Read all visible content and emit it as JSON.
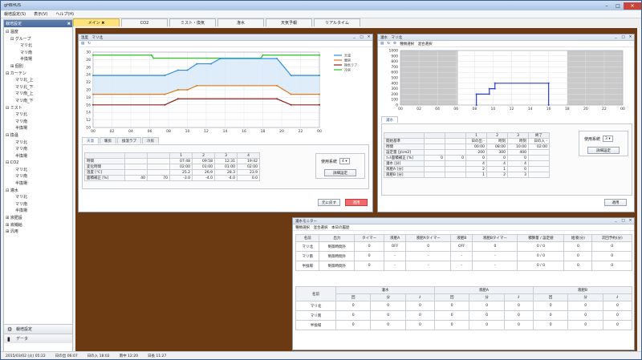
{
  "app": {
    "title": "gHBHUS",
    "menu": [
      "栽培設定(S)",
      "表示(V)",
      "ヘルプ(H)"
    ],
    "tabs": [
      {
        "label": "メイン ✖",
        "active": true
      },
      {
        "label": "CO2",
        "active": false
      },
      {
        "label": "ミスト・換気",
        "active": false
      },
      {
        "label": "潅水",
        "active": false
      },
      {
        "label": "天気予報",
        "active": false
      },
      {
        "label": "リアルタイム",
        "active": false
      }
    ]
  },
  "sidebar": {
    "header": "栽培設定",
    "close": "✖",
    "tree": [
      {
        "label": "⊟ 温度",
        "level": 0
      },
      {
        "label": "⊟ グループ",
        "level": 1
      },
      {
        "label": "マリ北",
        "level": 3
      },
      {
        "label": "マリ南",
        "level": 3
      },
      {
        "label": "半換場",
        "level": 3
      },
      {
        "label": "⊞ 個別",
        "level": 1
      },
      {
        "label": "⊟ カーテン",
        "level": 0
      },
      {
        "label": "マリ北_上",
        "level": 2
      },
      {
        "label": "マリ北_下",
        "level": 2
      },
      {
        "label": "マリ南_上",
        "level": 2
      },
      {
        "label": "マリ南_下",
        "level": 2
      },
      {
        "label": "⊟ ミスト",
        "level": 0
      },
      {
        "label": "マリ北",
        "level": 2
      },
      {
        "label": "マリ南",
        "level": 2
      },
      {
        "label": "半換場",
        "level": 2
      },
      {
        "label": "⊟ 換温",
        "level": 0
      },
      {
        "label": "マリ北",
        "level": 2
      },
      {
        "label": "マリ南",
        "level": 2
      },
      {
        "label": "半換場",
        "level": 2
      },
      {
        "label": "⊟ CO2",
        "level": 0
      },
      {
        "label": "マリ北",
        "level": 2
      },
      {
        "label": "マリ南",
        "level": 2
      },
      {
        "label": "半換場",
        "level": 2
      },
      {
        "label": "⊟ 灌水",
        "level": 0
      },
      {
        "label": "マリ北",
        "level": 2
      },
      {
        "label": "マリ南",
        "level": 2
      },
      {
        "label": "半換場",
        "level": 2
      },
      {
        "label": "⊞ 液肥設",
        "level": 0
      },
      {
        "label": "⊞ 液補給",
        "level": 0
      },
      {
        "label": "⊞ 汎用",
        "level": 0
      }
    ],
    "bottom_buttons": [
      "栽培設定",
      "データ"
    ]
  },
  "status": [
    "2015/03/02 (火) 05:22",
    "日の出 06:07",
    "日の入 18:02",
    "南中 12:20",
    "日長 11:27"
  ],
  "temp_panel": {
    "title": "温度　マリ北",
    "legend": [
      {
        "name": "天温",
        "color": "#2f8fe0"
      },
      {
        "name": "暖房",
        "color": "#e07a1f"
      },
      {
        "name": "換気ラブ",
        "color": "#8b2020"
      },
      {
        "name": "冷房",
        "color": "#27c427"
      }
    ],
    "subtabs": [
      "天温",
      "暖房",
      "換温ラブ",
      "冷房"
    ],
    "table": {
      "headers": [
        "",
        "",
        "",
        "1",
        "2",
        "3",
        "4"
      ],
      "rows": [
        [
          "時間",
          "",
          "",
          "07:48",
          "09:58",
          "12:31",
          "19:42"
        ],
        [
          "変化時間",
          "",
          "",
          "02:00",
          "01:00",
          "01:00",
          "02:00"
        ],
        [
          "温度 [℃]",
          "",
          "",
          "25.2",
          "26.9",
          "28.3",
          "23.9"
        ],
        [
          "面積補正 [%]",
          "40",
          "70",
          "-3.0",
          "-4.0",
          "-4.0",
          "0.0"
        ]
      ]
    },
    "mode_label": "使用系統",
    "mode_value": "4",
    "detail_button": "詳細設定",
    "revert_button": "元に戻す",
    "apply_button": "適用"
  },
  "irr_panel": {
    "title": "灌水　マリ北",
    "tools": "種類選択　混合選択",
    "subtab": "灌水",
    "table": {
      "headers": [
        "",
        "",
        "",
        "1",
        "2",
        "3",
        "終了"
      ],
      "rows": [
        [
          "開始基準",
          "",
          "",
          "日の出 -",
          "時刻",
          "時刻",
          "日の入 -"
        ],
        [
          "時間",
          "",
          "",
          "00:00",
          "08:00",
          "10:00",
          "02:00"
        ],
        [
          "設定量 [J/cm2]",
          "",
          "",
          "200",
          "300",
          "400",
          ""
        ],
        [
          "ﾌｨﾙ面積補正 [%]",
          "0",
          "0",
          "0",
          "0",
          "0",
          ""
        ],
        [
          "灌水 [分]",
          "",
          "",
          "4",
          "4",
          "4",
          ""
        ],
        [
          "液肥A [分]",
          "",
          "",
          "2",
          "1",
          "0",
          ""
        ],
        [
          "液肥B [分]",
          "",
          "",
          "1",
          "2",
          "3",
          ""
        ]
      ]
    },
    "mode_label": "使用系統",
    "mode_value": "3",
    "detail_button": "詳細設定",
    "apply_button": "適用"
  },
  "monitor_panel": {
    "title": "灌水モニター",
    "tools": "種類選択　混合選択　本日の履歴",
    "top_headers": [
      "名前",
      "出力",
      "タイマー",
      "液肥A",
      "液肥Aタイマー",
      "液肥B",
      "液肥Bタイマー",
      "積算量 / 設定値",
      "給液(分)",
      "次回予約(分)"
    ],
    "top_rows": [
      [
        "マリ北",
        "制御時間外",
        "0",
        "OFF",
        "0",
        "OFF",
        "0",
        "0 / 0",
        "0",
        "0"
      ],
      [
        "マリ南",
        "制御時間外",
        "0",
        "-",
        "-",
        "-",
        "-",
        "0 / 0",
        "0",
        "0"
      ],
      [
        "半換場",
        "制御時間外",
        "0",
        "-",
        "-",
        "-",
        "-",
        "0 / 0",
        "0",
        "0"
      ]
    ],
    "bottom_groups": [
      "灌水",
      "液肥A",
      "液肥B"
    ],
    "bottom_sub": [
      "回",
      "分",
      "ℓ"
    ],
    "bottom_rows": [
      [
        "マリ北",
        "0",
        "0",
        "0",
        "0",
        "0",
        "0",
        "0",
        "0",
        "0"
      ],
      [
        "マリ南",
        "0",
        "0",
        "0",
        "0",
        "0",
        "0",
        "0",
        "0",
        "0"
      ],
      [
        "半換場",
        "0",
        "0",
        "0",
        "0",
        "0",
        "0",
        "0",
        "0",
        "0"
      ]
    ],
    "name_header": "名前"
  },
  "chart_data": [
    {
      "type": "line",
      "x_ticks": [
        "00",
        "02",
        "04",
        "06",
        "08",
        "10",
        "12",
        "14",
        "16",
        "18",
        "20",
        "22",
        "00"
      ],
      "y_ticks": [
        "10",
        "12",
        "14",
        "16",
        "18",
        "20",
        "22",
        "24",
        "26",
        "28",
        "30"
      ],
      "xlim": [
        0,
        24
      ],
      "ylim": [
        10,
        30
      ],
      "series": [
        {
          "name": "冷房",
          "color": "#27c427",
          "points": [
            [
              0,
              29.2
            ],
            [
              6.2,
              29.2
            ],
            [
              6.4,
              28.4
            ],
            [
              17.8,
              28.4
            ],
            [
              18,
              29.2
            ],
            [
              24,
              29.2
            ]
          ]
        },
        {
          "name": "天温",
          "color": "#2f8fe0",
          "points": [
            [
              0,
              23.8
            ],
            [
              7.6,
              23.8
            ],
            [
              9,
              25.2
            ],
            [
              10,
              25.2
            ],
            [
              11,
              26.9
            ],
            [
              12.5,
              26.9
            ],
            [
              13.5,
              28.3
            ],
            [
              19.5,
              28.3
            ],
            [
              21,
              23.8
            ],
            [
              24,
              23.8
            ]
          ]
        },
        {
          "name": "暖房",
          "color": "#e07a1f",
          "points": [
            [
              0,
              18.8
            ],
            [
              7.6,
              18.8
            ],
            [
              9,
              20.0
            ],
            [
              10,
              20.0
            ],
            [
              11,
              21.1
            ],
            [
              19.5,
              21.1
            ],
            [
              21,
              18.8
            ],
            [
              24,
              18.8
            ]
          ]
        },
        {
          "name": "換気ラブ",
          "color": "#8b2020",
          "points": [
            [
              0,
              16.0
            ],
            [
              7.6,
              16.0
            ],
            [
              9,
              17.6
            ],
            [
              19.5,
              17.6
            ],
            [
              21,
              16.0
            ],
            [
              24,
              16.0
            ]
          ]
        }
      ],
      "legend_position": "top-right",
      "grid": true
    },
    {
      "type": "line",
      "x_ticks": [
        "00",
        "02",
        "04",
        "06",
        "08",
        "10",
        "12",
        "14",
        "16",
        "18",
        "20",
        "22",
        "00"
      ],
      "y_ticks": [
        "0",
        "100",
        "200",
        "300",
        "400",
        "500",
        "600",
        "700",
        "800",
        "900",
        "1000"
      ],
      "xlim": [
        0,
        24
      ],
      "ylim": [
        0,
        1000
      ],
      "series": [
        {
          "name": "灌水",
          "color": "#2b3fd6",
          "points": [
            [
              8.2,
              0
            ],
            [
              8.2,
              200
            ],
            [
              9.6,
              200
            ],
            [
              9.6,
              300
            ],
            [
              10.2,
              300
            ],
            [
              10.2,
              400
            ],
            [
              16,
              400
            ],
            [
              16,
              0
            ]
          ]
        }
      ],
      "grid": true
    }
  ]
}
